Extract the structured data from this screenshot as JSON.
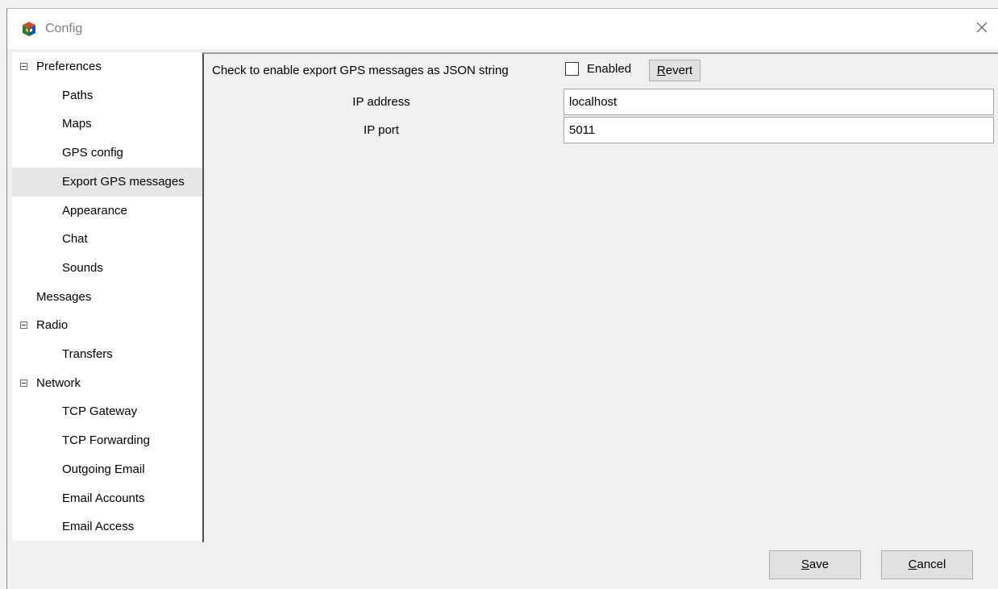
{
  "window": {
    "title": "Config"
  },
  "tree": [
    {
      "label": "Preferences",
      "level": 0,
      "expander": true
    },
    {
      "label": "Paths",
      "level": 1
    },
    {
      "label": "Maps",
      "level": 1
    },
    {
      "label": "GPS config",
      "level": 1
    },
    {
      "label": "Export GPS messages",
      "level": 1,
      "selected": true
    },
    {
      "label": "Appearance",
      "level": 1
    },
    {
      "label": "Chat",
      "level": 1
    },
    {
      "label": "Sounds",
      "level": 1
    },
    {
      "label": "Messages",
      "level": 0,
      "expander": false
    },
    {
      "label": "Radio",
      "level": 0,
      "expander": true
    },
    {
      "label": "Transfers",
      "level": 1
    },
    {
      "label": "Network",
      "level": 0,
      "expander": true
    },
    {
      "label": "TCP Gateway",
      "level": 1
    },
    {
      "label": "TCP Forwarding",
      "level": 1
    },
    {
      "label": "Outgoing Email",
      "level": 1
    },
    {
      "label": "Email Accounts",
      "level": 1
    },
    {
      "label": "Email Access",
      "level": 1
    }
  ],
  "form": {
    "description": "Check to enable export GPS messages as JSON string",
    "enabled_label": "Enabled",
    "enabled_checked": false,
    "revert": {
      "mnemonic": "R",
      "rest": "evert"
    },
    "ip_address": {
      "label": "IP address",
      "value": "localhost"
    },
    "ip_port": {
      "label": "IP port",
      "value": "5011"
    }
  },
  "buttons": {
    "save": {
      "mnemonic": "S",
      "rest": "ave"
    },
    "cancel": {
      "mnemonic": "C",
      "rest": "ancel"
    }
  },
  "icons": {
    "app": "app-cube-icon",
    "close": "close-icon",
    "expander": "collapse-box-icon"
  },
  "colors": {
    "selected_bg": "#e6e6e6",
    "window_bg": "#f0f0f0",
    "button_bg": "#e1e1e1"
  }
}
